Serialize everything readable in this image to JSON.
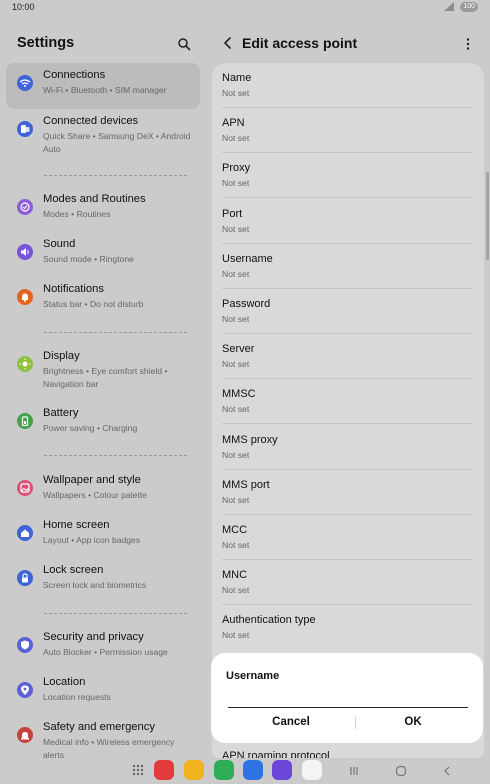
{
  "status": {
    "time": "10:00",
    "battery": "100"
  },
  "settings": {
    "title": "Settings",
    "items": [
      {
        "label": "Connections",
        "sub": "Wi-Fi • Bluetooth • SIM manager",
        "icon": "wifi-icon",
        "color": "#3f63d9"
      },
      {
        "label": "Connected devices",
        "sub": "Quick Share • Samsung DeX • Android Auto",
        "icon": "devices-icon",
        "color": "#3f63d9"
      },
      {
        "label": "Modes and Routines",
        "sub": "Modes • Routines",
        "icon": "routines-icon",
        "color": "#8e5bd9"
      },
      {
        "label": "Sound",
        "sub": "Sound mode • Ringtone",
        "icon": "sound-icon",
        "color": "#7a54d6"
      },
      {
        "label": "Notifications",
        "sub": "Status bar • Do not disturb",
        "icon": "bell-icon",
        "color": "#e3641f"
      },
      {
        "label": "Display",
        "sub": "Brightness • Eye comfort shield • Navigation bar",
        "icon": "sun-icon",
        "color": "#8fc23a"
      },
      {
        "label": "Battery",
        "sub": "Power saving • Charging",
        "icon": "battery-icon",
        "color": "#45a14f"
      },
      {
        "label": "Wallpaper and style",
        "sub": "Wallpapers • Colour palette",
        "icon": "wallpaper-icon",
        "color": "#d9527a"
      },
      {
        "label": "Home screen",
        "sub": "Layout • App icon badges",
        "icon": "home-icon",
        "color": "#3f63d9"
      },
      {
        "label": "Lock screen",
        "sub": "Screen lock and biometrics",
        "icon": "lock-icon",
        "color": "#3f63d9"
      },
      {
        "label": "Security and privacy",
        "sub": "Auto Blocker • Permission usage",
        "icon": "shield-icon",
        "color": "#5b62d9"
      },
      {
        "label": "Location",
        "sub": "Location requests",
        "icon": "location-icon",
        "color": "#5b62d9"
      },
      {
        "label": "Safety and emergency",
        "sub": "Medical info • Wireless emergency alerts",
        "icon": "emergency-icon",
        "color": "#c9413f"
      }
    ]
  },
  "apn": {
    "title": "Edit access point",
    "not_set": "Not set",
    "fields": [
      "Name",
      "APN",
      "Proxy",
      "Port",
      "Username",
      "Password",
      "Server",
      "MMSC",
      "MMS proxy",
      "MMS port",
      "MCC",
      "MNC",
      "Authentication type"
    ],
    "partial_label": "APN roaming protocol"
  },
  "dialog": {
    "title": "Username",
    "value": "",
    "cancel": "Cancel",
    "ok": "OK"
  },
  "dock": {
    "apps": [
      {
        "name": "app-drawer-icon",
        "color": "#cbcbcb"
      },
      {
        "name": "flipboard-icon",
        "color": "#e33b3b"
      },
      {
        "name": "my-files-icon",
        "color": "#f3b320"
      },
      {
        "name": "phone-icon",
        "color": "#2fae58"
      },
      {
        "name": "messages-icon",
        "color": "#2d73e3"
      },
      {
        "name": "internet-icon",
        "color": "#6b46d9"
      },
      {
        "name": "camera-icon",
        "color": "#f4f4f4"
      }
    ]
  }
}
